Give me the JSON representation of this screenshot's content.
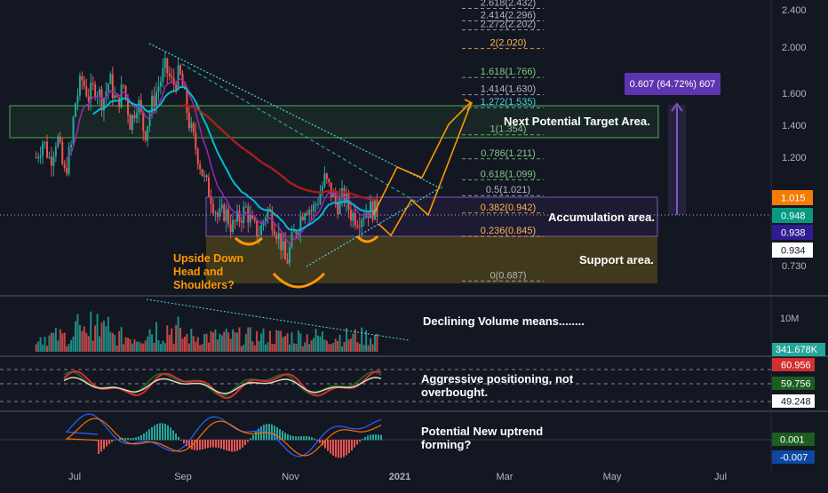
{
  "chart_data": [
    {
      "panel": "price",
      "type": "candlestick",
      "x_ticks": [
        "Jul",
        "Sep",
        "Nov",
        "2021",
        "Mar",
        "May",
        "Jul"
      ],
      "y_scale": "log",
      "y_ticks": [
        "2.400",
        "2.000",
        "1.600",
        "1.400",
        "1.200",
        "0.730"
      ],
      "ylim": [
        0.62,
        2.6
      ],
      "price_labels": [
        {
          "text": "1.015",
          "value": 1.015,
          "color": "#f57c00"
        },
        {
          "text": "0.948",
          "value": 0.948,
          "color": "#089981"
        },
        {
          "text": "0.938",
          "value": 0.938,
          "color": "#311b92"
        },
        {
          "text": "0.934",
          "value": 0.934,
          "color": "#ffffff"
        }
      ],
      "fib_levels": [
        {
          "text": "2.618(2.432)",
          "value": 2.432
        },
        {
          "text": "2.414(2.296)",
          "value": 2.296
        },
        {
          "text": "2.272(2.202)",
          "value": 2.202
        },
        {
          "text": "2(2.020)",
          "value": 2.02
        },
        {
          "text": "1.618(1.766)",
          "value": 1.766
        },
        {
          "text": "1.414(1.630)",
          "value": 1.63
        },
        {
          "text": "1.272(1.535)",
          "value": 1.535
        },
        {
          "text": "1(1.354)",
          "value": 1.354
        },
        {
          "text": "0.786(1.211)",
          "value": 1.211
        },
        {
          "text": "0.618(1.099)",
          "value": 1.099
        },
        {
          "text": "0.5(1.021)",
          "value": 1.021
        },
        {
          "text": "0.382(0.942)",
          "value": 0.942
        },
        {
          "text": "0.236(0.845)",
          "value": 0.845
        },
        {
          "text": "0(0.687)",
          "value": 0.687
        }
      ],
      "measure_label": "0.607 (64.72%) 607",
      "annotations": [
        "Next Potential Target Area.",
        "Accumulation area.",
        "Support area.",
        "Upside Down",
        "Head and",
        "Shoulders?"
      ],
      "colors": {
        "up": "#26a69a",
        "down": "#ef5350",
        "ema_fast": "#00bcd4",
        "ema_slow": "#b71c1c",
        "ema_mid": "#9c27b0",
        "projection": "#ff9800"
      }
    },
    {
      "panel": "volume",
      "type": "bar",
      "y_ticks": [
        "10M"
      ],
      "last_value_label": "341.678K",
      "annotation": "Declining Volume means........"
    },
    {
      "panel": "rsi",
      "type": "line",
      "value_labels": [
        {
          "text": "60.956",
          "color": "#d32f2f"
        },
        {
          "text": "59.756",
          "color": "#1b5e20"
        },
        {
          "text": "49.248",
          "color": "#ffffff"
        }
      ],
      "annotation": [
        "Aggressive positioning, not",
        "overbought."
      ]
    },
    {
      "panel": "macd",
      "type": "bar",
      "value_labels": [
        {
          "text": "0.001",
          "color": "#1b5e20"
        },
        {
          "text": "-0.007",
          "color": "#0d47a1"
        }
      ],
      "annotation": [
        "Potential New uptrend",
        "forming?"
      ]
    }
  ]
}
